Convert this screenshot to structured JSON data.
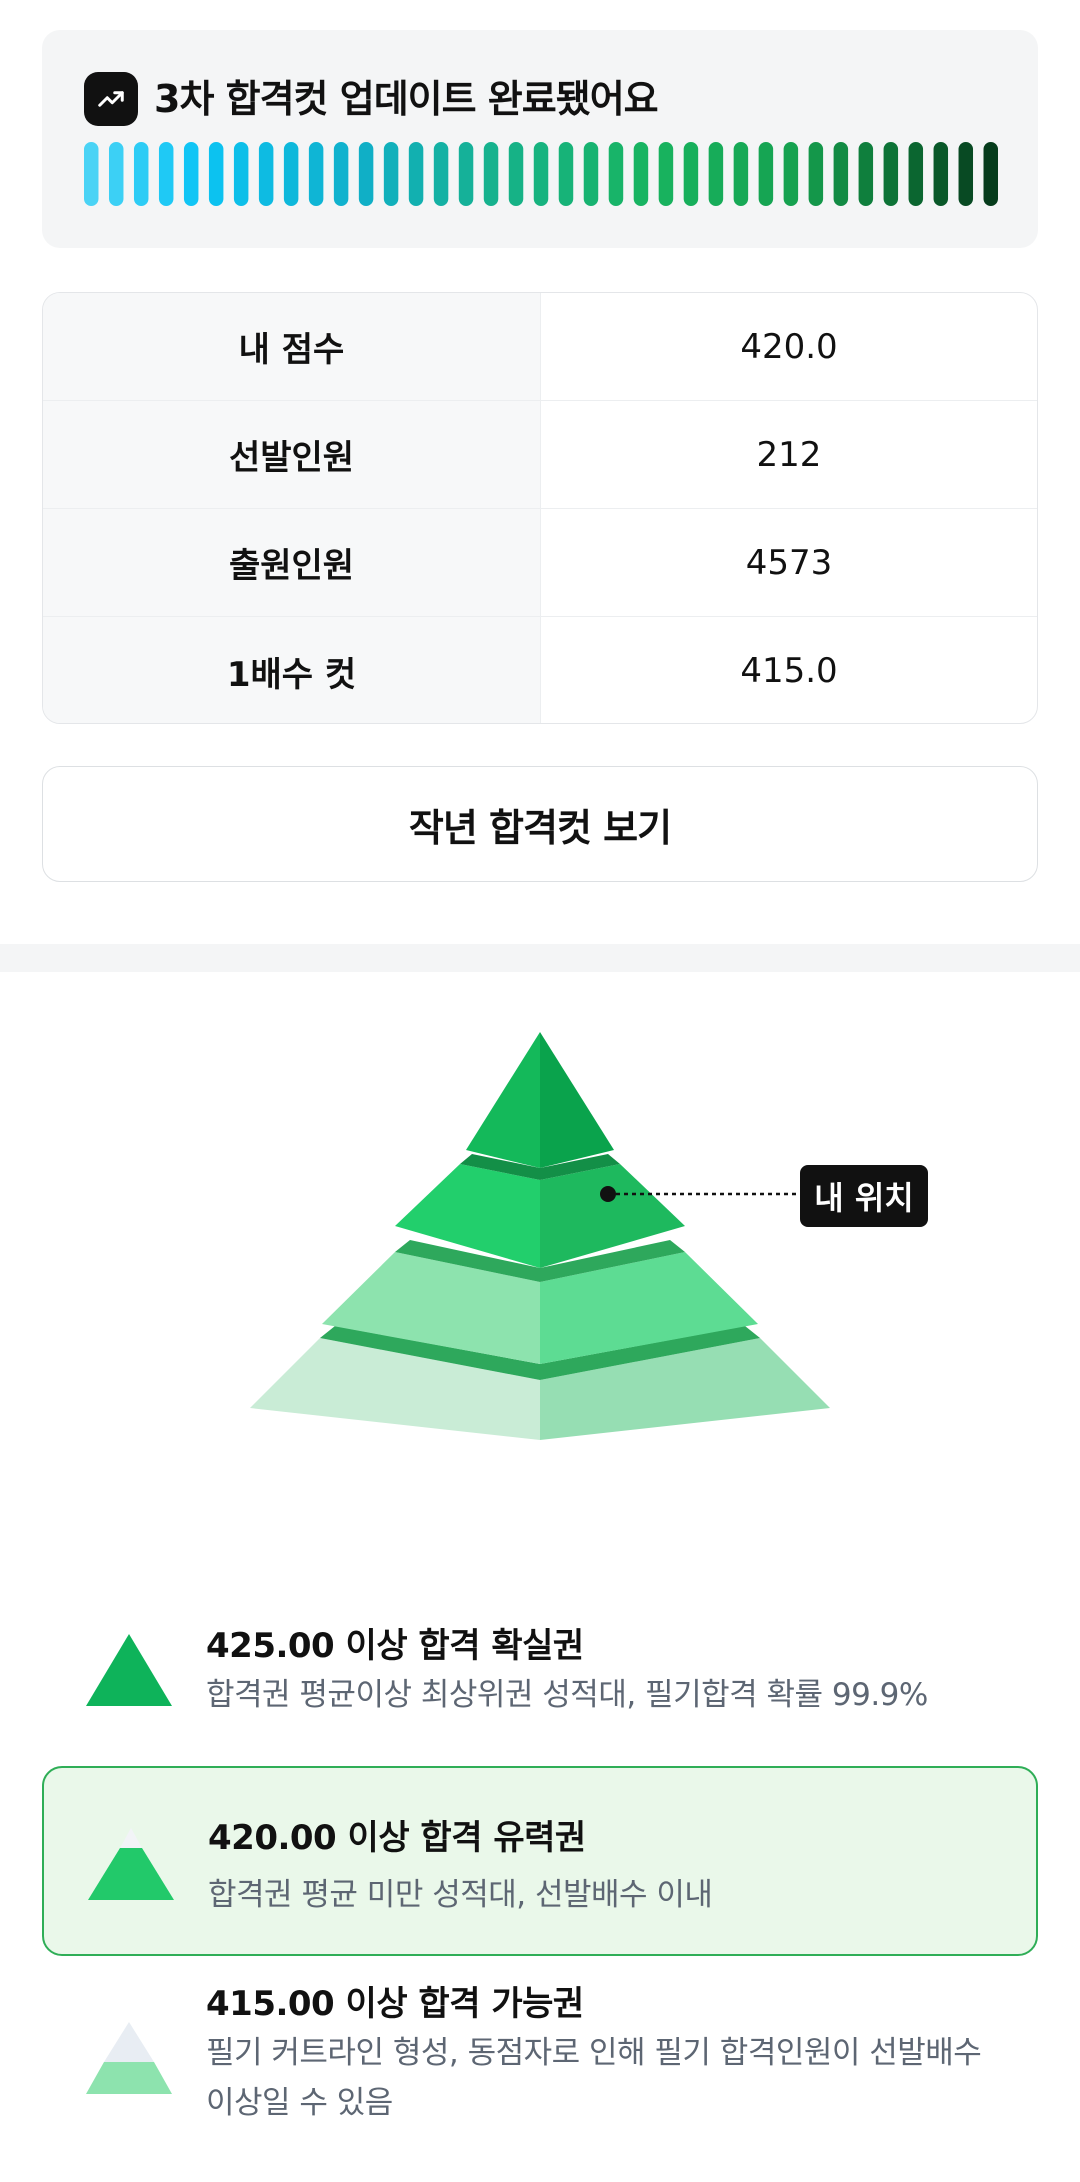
{
  "update_card": {
    "title": "3차 합격컷 업데이트 완료됐어요",
    "icon": "trending-up-icon",
    "progress_segments": 37
  },
  "score_table": {
    "rows": [
      {
        "label": "내 점수",
        "value": "420.0"
      },
      {
        "label": "선발인원",
        "value": "212"
      },
      {
        "label": "출원인원",
        "value": "4573"
      },
      {
        "label": "1배수 컷",
        "value": "415.0"
      }
    ]
  },
  "prev_cutoff_button": {
    "label": "작년 합격컷 보기"
  },
  "pyramid": {
    "my_position_label": "내 위치",
    "my_position_tier": 2,
    "colors": {
      "tier1": "#0eb35a",
      "tier2": "#22c96a",
      "tier3": "#8de3ae",
      "tier4": "#c9ecd6"
    }
  },
  "tiers": [
    {
      "title": "425.00 이상 합격 확실권",
      "description": "합격권 평균이상 최상위권 성적대, 필기합격 확률 99.9%",
      "highlighted": false
    },
    {
      "title": "420.00 이상 합격 유력권",
      "description": "합격권 평균 미만 성적대, 선발배수 이내",
      "highlighted": true
    },
    {
      "title": "415.00 이상 합격 가능권",
      "description": "필기 커트라인 형성, 동점자로 인해 필기 합격인원이 선발배수 이상일 수 있음",
      "highlighted": false
    }
  ]
}
